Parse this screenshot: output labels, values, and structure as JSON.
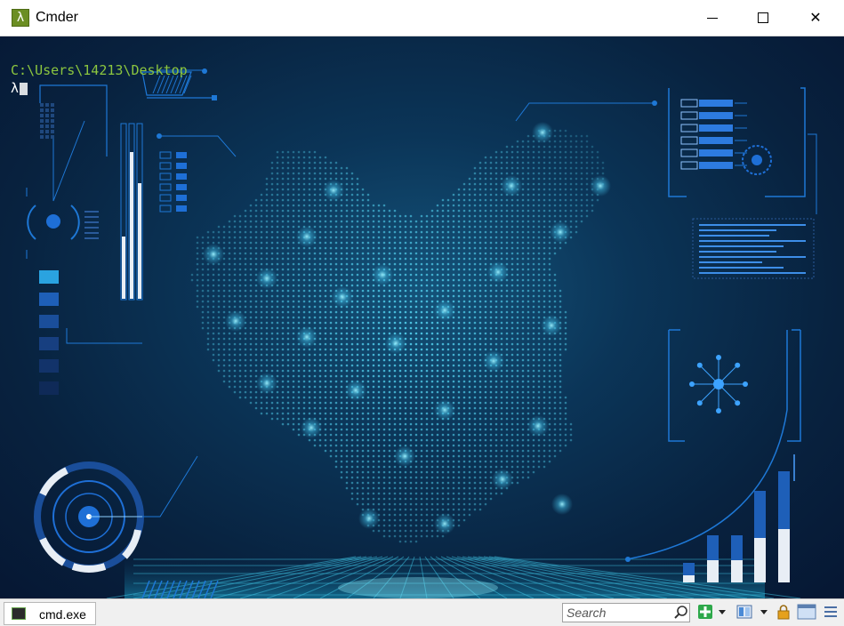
{
  "window": {
    "title": "Cmder",
    "app_icon_glyph": "λ",
    "controls": {
      "minimize": "minimize-icon",
      "maximize": "maximize-icon",
      "close_glyph": "✕"
    }
  },
  "console": {
    "path_line": "C:\\Users\\14213\\Desktop",
    "prompt_symbol": "λ",
    "path_color": "#8cc63f"
  },
  "tabbar": {
    "tab_label": "cmd.exe",
    "search_placeholder": "Search",
    "icons": [
      "search-icon",
      "new-tab-plus-icon",
      "dropdown-icon",
      "split-view-icon",
      "dropdown-icon",
      "lock-icon",
      "window-icon",
      "menu-icon"
    ]
  },
  "colors": {
    "background_dark": "#061733",
    "accent_blue": "#1e78d6",
    "dot_cyan": "#4fc8e6"
  }
}
